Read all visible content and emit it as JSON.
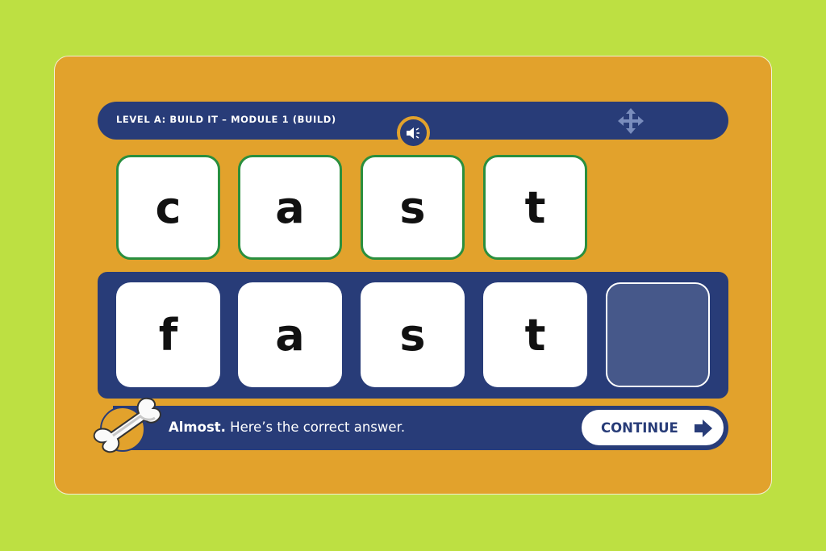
{
  "header": {
    "title": "LEVEL A: BUILD IT – MODULE 1 (BUILD)",
    "audio_icon": "speaker-icon",
    "drag_icon": "move-arrows-icon"
  },
  "target_word": {
    "letters": [
      "c",
      "a",
      "s",
      "t"
    ],
    "state": "correct"
  },
  "answer_row": {
    "letters": [
      "f",
      "a",
      "s",
      "t",
      ""
    ],
    "empty_slots": 1
  },
  "feedback": {
    "mascot_icon": "bone-icon",
    "bold_text": "Almost.",
    "text": " Here’s the correct answer."
  },
  "continue_button": {
    "label": "CONTINUE",
    "icon": "arrow-right-icon"
  },
  "colors": {
    "background": "#bde042",
    "card": "#e2a22c",
    "navy": "#283c78",
    "tile_border_correct": "#2a8f3e",
    "empty_slot": "#46588a"
  }
}
